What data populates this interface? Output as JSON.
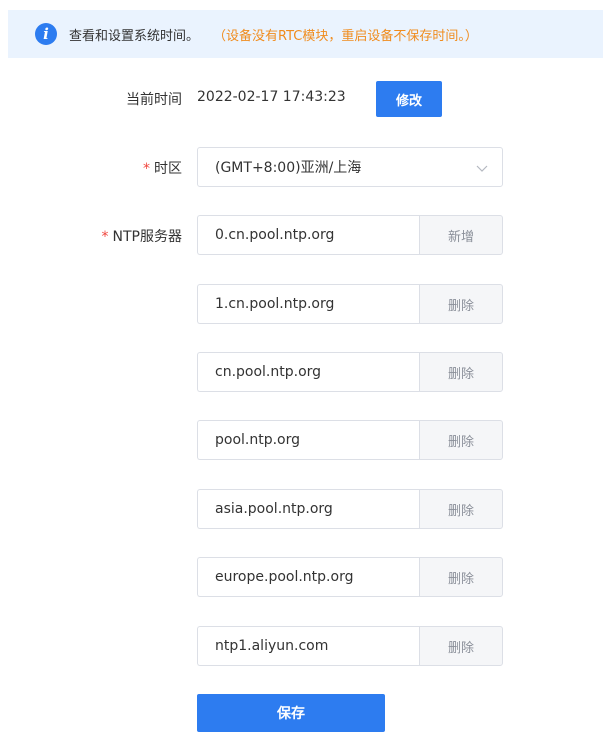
{
  "banner": {
    "icon": "info-icon",
    "icon_glyph": "i",
    "text": "查看和设置系统时间。",
    "warning": "（设备没有RTC模块，重启设备不保存时间。）",
    "background": "#eaf3fe",
    "warning_color": "#f08c1e"
  },
  "current_time": {
    "label": "当前时间",
    "value": "2022-02-17 17:43:23",
    "edit_label": "修改"
  },
  "timezone": {
    "required_mark": "*",
    "label": "时区",
    "selected": "(GMT+8:00)亚洲/上海",
    "icon": "chevron-down-icon"
  },
  "ntp": {
    "required_mark": "*",
    "label": "NTP服务器",
    "servers": [
      {
        "value": "0.cn.pool.ntp.org",
        "action": "新增"
      },
      {
        "value": "1.cn.pool.ntp.org",
        "action": "删除"
      },
      {
        "value": "cn.pool.ntp.org",
        "action": "删除"
      },
      {
        "value": "pool.ntp.org",
        "action": "删除"
      },
      {
        "value": "asia.pool.ntp.org",
        "action": "删除"
      },
      {
        "value": "europe.pool.ntp.org",
        "action": "删除"
      },
      {
        "value": "ntp1.aliyun.com",
        "action": "删除"
      }
    ]
  },
  "save_label": "保存",
  "colors": {
    "primary": "#2d7cf0",
    "required": "#f0453d",
    "border": "#dcdfe6"
  }
}
